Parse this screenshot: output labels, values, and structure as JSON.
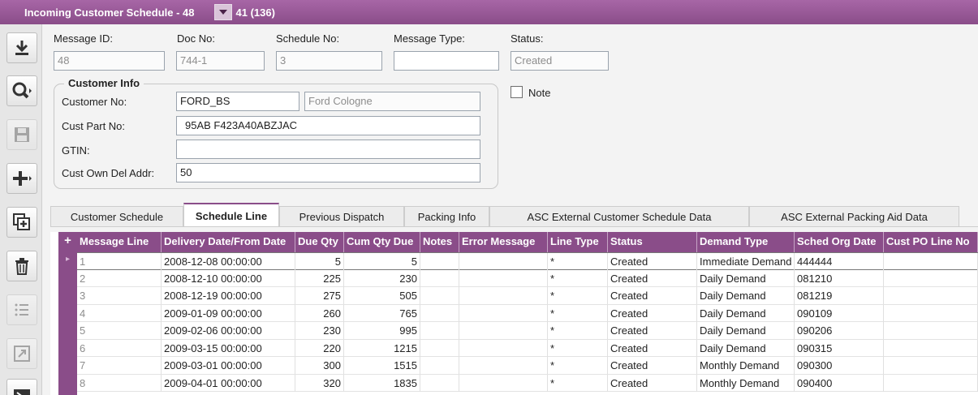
{
  "window": {
    "title": "Incoming Customer Schedule - 48",
    "record_nav": "41 (136)"
  },
  "toolbar": {
    "tools": [
      {
        "name": "download",
        "icon": "download-icon",
        "enabled": true
      },
      {
        "name": "search",
        "icon": "search-icon",
        "enabled": true
      },
      {
        "name": "save",
        "icon": "save-icon",
        "enabled": false
      },
      {
        "name": "new",
        "icon": "plus-icon",
        "enabled": true
      },
      {
        "name": "copy",
        "icon": "copy-add-icon",
        "enabled": true
      },
      {
        "name": "delete",
        "icon": "trash-icon",
        "enabled": true
      },
      {
        "name": "list",
        "icon": "list-icon",
        "enabled": false
      },
      {
        "name": "expand",
        "icon": "expand-icon",
        "enabled": false
      },
      {
        "name": "more",
        "icon": "panel-icon",
        "enabled": true
      }
    ]
  },
  "header": {
    "message_id": {
      "label": "Message ID:",
      "value": "48"
    },
    "doc_no": {
      "label": "Doc No:",
      "value": "744-1"
    },
    "schedule_no": {
      "label": "Schedule No:",
      "value": "3"
    },
    "message_type": {
      "label": "Message Type:",
      "value": ""
    },
    "status": {
      "label": "Status:",
      "value": "Created"
    }
  },
  "customer_info": {
    "title": "Customer Info",
    "customer_no": {
      "label": "Customer No:",
      "value": "FORD_BS",
      "name": "Ford Cologne"
    },
    "cust_part_no": {
      "label": "Cust Part No:",
      "value": "95AB F423A40ABZJAC"
    },
    "gtin": {
      "label": "GTIN:",
      "value": ""
    },
    "cust_own_del_addr": {
      "label": "Cust Own Del Addr:",
      "value": "50"
    }
  },
  "note": {
    "label": "Note",
    "checked": false
  },
  "tabs": [
    {
      "label": "Customer Schedule",
      "active": false
    },
    {
      "label": "Schedule Line",
      "active": true
    },
    {
      "label": "Previous Dispatch",
      "active": false
    },
    {
      "label": "Packing Info",
      "active": false
    },
    {
      "label": "ASC External Customer Schedule Data",
      "active": false
    },
    {
      "label": "ASC External Packing Aid Data",
      "active": false
    }
  ],
  "grid": {
    "add_symbol": "+",
    "row_marker": "▸",
    "columns": [
      "Message Line",
      "Delivery Date/From Date",
      "Due Qty",
      "Cum Qty Due",
      "Notes",
      "Error Message",
      "Line Type",
      "Status",
      "Demand Type",
      "Sched Org Date",
      "Cust PO Line No"
    ],
    "rows": [
      [
        "1",
        "2008-12-08 00:00:00",
        "5",
        "5",
        "",
        "",
        "*",
        "Created",
        "Immediate Demand",
        "444444",
        ""
      ],
      [
        "2",
        "2008-12-10 00:00:00",
        "225",
        "230",
        "",
        "",
        "*",
        "Created",
        "Daily Demand",
        "081210",
        ""
      ],
      [
        "3",
        "2008-12-19 00:00:00",
        "275",
        "505",
        "",
        "",
        "*",
        "Created",
        "Daily Demand",
        "081219",
        ""
      ],
      [
        "4",
        "2009-01-09 00:00:00",
        "260",
        "765",
        "",
        "",
        "*",
        "Created",
        "Daily Demand",
        "090109",
        ""
      ],
      [
        "5",
        "2009-02-06 00:00:00",
        "230",
        "995",
        "",
        "",
        "*",
        "Created",
        "Daily Demand",
        "090206",
        ""
      ],
      [
        "6",
        "2009-03-15 00:00:00",
        "220",
        "1215",
        "",
        "",
        "*",
        "Created",
        "Daily Demand",
        "090315",
        ""
      ],
      [
        "7",
        "2009-03-01 00:00:00",
        "300",
        "1515",
        "",
        "",
        "*",
        "Created",
        "Monthly Demand",
        "090300",
        ""
      ],
      [
        "8",
        "2009-04-01 00:00:00",
        "320",
        "1835",
        "",
        "",
        "*",
        "Created",
        "Monthly Demand",
        "090400",
        ""
      ]
    ]
  }
}
